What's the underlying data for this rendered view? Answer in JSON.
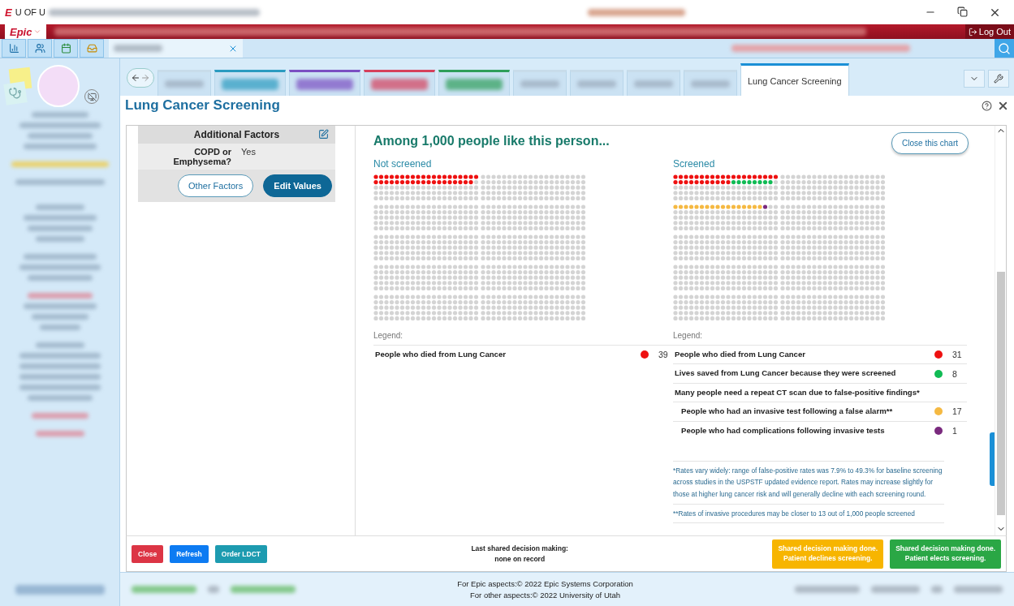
{
  "titlebar": {
    "app_letter": "E",
    "title": "U OF U"
  },
  "menubar": {
    "epic_label": "Epic",
    "logout_label": "Log Out"
  },
  "nav_tabs": [
    {
      "selected": false,
      "color": "#c8dcea"
    },
    {
      "selected": false,
      "color": "#2a9bc0"
    },
    {
      "selected": false,
      "color": "#7b4fc2"
    },
    {
      "selected": false,
      "color": "#d6405c"
    },
    {
      "selected": false,
      "color": "#2e9e5a"
    },
    {
      "selected": false,
      "color": "#c8dcea"
    },
    {
      "selected": false,
      "color": "#c8dcea"
    },
    {
      "selected": false,
      "color": "#c8dcea"
    },
    {
      "selected": false,
      "color": "#c8dcea"
    },
    {
      "label": "Lung Cancer Screening",
      "selected": true,
      "color": "#1a8fd6"
    }
  ],
  "page": {
    "title": "Lung Cancer Screening"
  },
  "factors": {
    "title": "Additional Factors",
    "rows": [
      {
        "label": "COPD or Emphysema?",
        "value": "Yes"
      }
    ],
    "buttons": [
      {
        "label": "Other Factors",
        "kind": "outline"
      },
      {
        "label": "Edit Values",
        "kind": "primary"
      }
    ]
  },
  "chart": {
    "heading": "Among 1,000 people like this person...",
    "close_label": "Close this chart",
    "groups": [
      {
        "title": "Not screened",
        "legend_label": "Legend:",
        "items": [
          {
            "kind": "main",
            "label": "People who died from Lung Cancer",
            "color": "#ee1111",
            "count": "39"
          }
        ]
      },
      {
        "title": "Screened",
        "legend_label": "Legend:",
        "items": [
          {
            "kind": "main",
            "label": "People who died from Lung Cancer",
            "color": "#ee1111",
            "count": "31"
          },
          {
            "kind": "main",
            "label": "Lives saved from Lung Cancer because they were screened",
            "color": "#11bb55",
            "count": "8"
          },
          {
            "kind": "header",
            "label": "Many people need a repeat CT scan due to false-positive findings*"
          },
          {
            "kind": "sub",
            "label": "People who had an invasive test following a false alarm**",
            "color": "#f5b942",
            "count": "17"
          },
          {
            "kind": "sub",
            "label": "People who had complications following invasive tests",
            "color": "#7a2a7e",
            "count": "1"
          }
        ]
      }
    ],
    "footnotes": [
      "*Rates vary widely: range of false-positive rates was 7.9% to 49.3% for baseline screening across studies in the USPSTF updated evidence report. Rates may increase slightly for those at higher lung cancer risk and will generally decline with each screening round.",
      "**Rates of invasive procedures may be closer to 13 out of 1,000 people screened"
    ]
  },
  "footer": {
    "buttons": [
      {
        "label": "Close",
        "kind": "danger"
      },
      {
        "label": "Refresh",
        "kind": "primary"
      },
      {
        "label": "Order LDCT",
        "kind": "teal"
      }
    ],
    "status_lines": [
      "Last shared decision making:",
      "none on record"
    ],
    "decisions": [
      {
        "kind": "warning",
        "lines": [
          "Shared decision making done.",
          "Patient declines screening."
        ]
      },
      {
        "kind": "success",
        "lines": [
          "Shared decision making done.",
          "Patient elects screening."
        ]
      }
    ]
  },
  "copyright": [
    "For Epic aspects:© 2022 Epic Systems Corporation",
    "For other aspects:© 2022 University of Utah"
  ]
}
